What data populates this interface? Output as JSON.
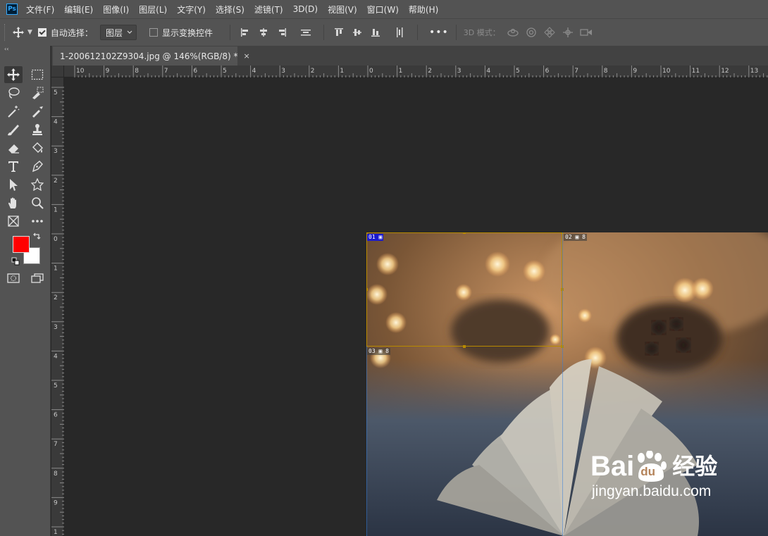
{
  "app": {
    "logo": "Ps"
  },
  "menu": [
    "文件(F)",
    "编辑(E)",
    "图像(I)",
    "图层(L)",
    "文字(Y)",
    "选择(S)",
    "滤镜(T)",
    "3D(D)",
    "视图(V)",
    "窗口(W)",
    "帮助(H)"
  ],
  "options": {
    "auto_select_label": "自动选择：",
    "auto_select_checked": true,
    "auto_select_target": "图层",
    "show_transform_label": "显示变换控件",
    "show_transform_checked": false,
    "more_label": "•••",
    "mode3d_label": "3D 模式："
  },
  "toolbar": {
    "collapse": "‹‹",
    "foreground_color": "#ff0000",
    "background_color": "#ffffff"
  },
  "document": {
    "tab_title": "1-200612102Z9304.jpg @ 146%(RGB/8) *",
    "close": "×"
  },
  "ruler_top": [
    "10",
    "9",
    "8",
    "7",
    "6",
    "5",
    "4",
    "3",
    "2",
    "1",
    "0",
    "1",
    "2",
    "3",
    "4",
    "5",
    "6",
    "7",
    "8",
    "9",
    "10",
    "11",
    "12",
    "13"
  ],
  "ruler_left": [
    "5",
    "4",
    "3",
    "2",
    "1",
    "0",
    "1",
    "2",
    "3",
    "4",
    "5",
    "6",
    "7",
    "8",
    "9",
    "1"
  ],
  "slices": [
    {
      "id": "01",
      "suffix": ""
    },
    {
      "id": "02",
      "suffix": "8"
    },
    {
      "id": "03",
      "suffix": "8"
    }
  ],
  "watermark": {
    "brand": "Bai",
    "brand2": "经验",
    "paw": "du",
    "url": "jingyan.baidu.com"
  }
}
